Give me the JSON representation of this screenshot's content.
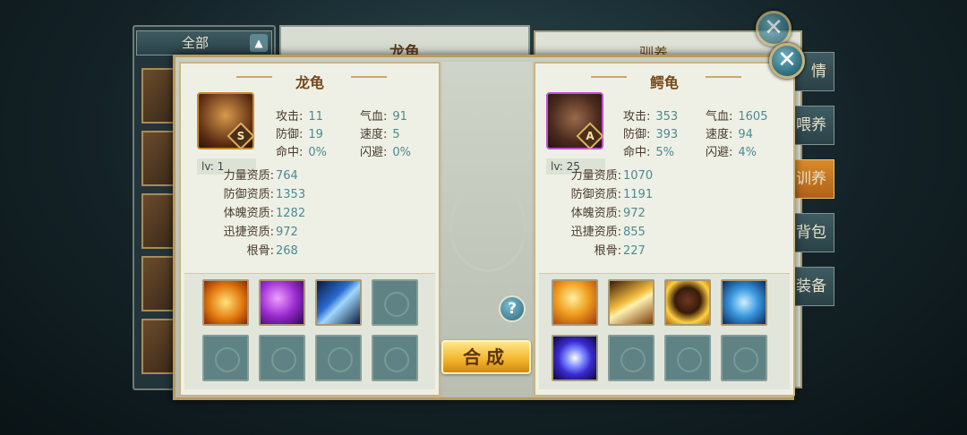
{
  "background": {
    "filter_label": "全部",
    "center_title": "龙龟",
    "right_title": "驯养",
    "side_tabs": [
      {
        "label": "情",
        "active": false
      },
      {
        "label": "喂养",
        "active": false
      },
      {
        "label": "训养",
        "active": true
      },
      {
        "label": "背包",
        "active": false
      },
      {
        "label": "装备",
        "active": false
      }
    ]
  },
  "close_label": "✕",
  "left_pet": {
    "name": "龙龟",
    "grade": "S",
    "level": "lv: 1",
    "stats": {
      "attack_label": "攻击:",
      "attack": "11",
      "hp_label": "气血:",
      "hp": "91",
      "defense_label": "防御:",
      "defense": "19",
      "speed_label": "速度:",
      "speed": "5",
      "hit_label": "命中:",
      "hit": "0%",
      "dodge_label": "闪避:",
      "dodge": "0%"
    },
    "aptitudes": [
      {
        "label": "力量资质:",
        "value": "764"
      },
      {
        "label": "防御资质:",
        "value": "1353"
      },
      {
        "label": "体魄资质:",
        "value": "1282"
      },
      {
        "label": "迅捷资质:",
        "value": "972"
      },
      {
        "label": "根骨:",
        "value": "268"
      }
    ],
    "skills": [
      "orange-shield-skill-icon",
      "purple-orb-skill-icon",
      "blue-claw-skill-icon",
      "empty",
      "empty",
      "empty",
      "empty",
      "empty"
    ]
  },
  "right_pet": {
    "name": "鳄龟",
    "grade": "A",
    "level": "lv: 25",
    "stats": {
      "attack_label": "攻击:",
      "attack": "353",
      "hp_label": "气血:",
      "hp": "1605",
      "defense_label": "防御:",
      "defense": "393",
      "speed_label": "速度:",
      "speed": "94",
      "hit_label": "命中:",
      "hit": "5%",
      "dodge_label": "闪避:",
      "dodge": "4%"
    },
    "aptitudes": [
      {
        "label": "力量资质:",
        "value": "1070"
      },
      {
        "label": "防御资质:",
        "value": "1191"
      },
      {
        "label": "体魄资质:",
        "value": "972"
      },
      {
        "label": "迅捷资质:",
        "value": "855"
      },
      {
        "label": "根骨:",
        "value": "227"
      }
    ],
    "skills": [
      "fire-beast-skill-icon",
      "golden-arrow-skill-icon",
      "beast-flame-skill-icon",
      "blue-heart-skill-icon",
      "vortex-skill-icon",
      "empty",
      "empty",
      "empty"
    ]
  },
  "help_label": "?",
  "merge_label": "合成"
}
